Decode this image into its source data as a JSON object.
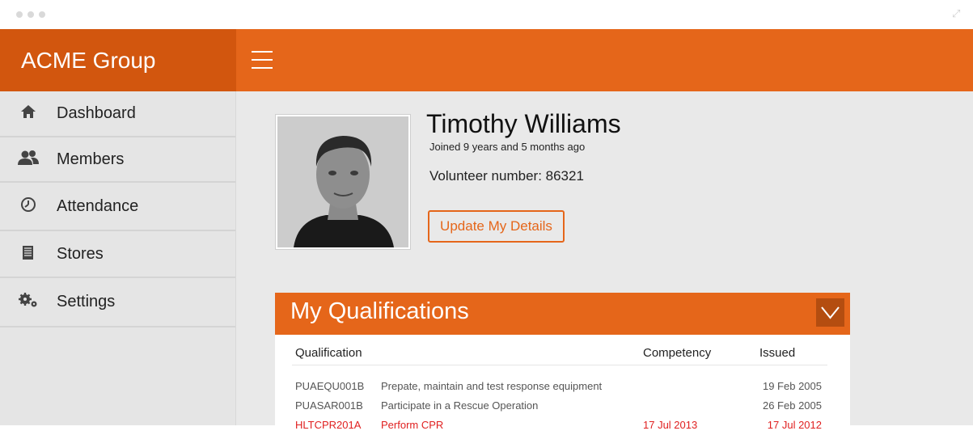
{
  "app": {
    "brand": "ACME Group",
    "accent": "#e5661a",
    "accent_dark": "#d2560e"
  },
  "sidebar": {
    "items": [
      {
        "label": "Dashboard",
        "icon": "home-icon"
      },
      {
        "label": "Members",
        "icon": "members-icon"
      },
      {
        "label": "Attendance",
        "icon": "clock-icon"
      },
      {
        "label": "Stores",
        "icon": "stores-icon"
      },
      {
        "label": "Settings",
        "icon": "gears-icon"
      }
    ]
  },
  "profile": {
    "name": "Timothy Williams",
    "joined": "Joined 9 years and 5 months ago",
    "volunteer": "Volunteer number: 86321",
    "update_label": "Update My Details"
  },
  "qualifications": {
    "title": "My Qualifications",
    "headers": {
      "qualification": "Qualification",
      "competency": "Competency",
      "issued": "Issued"
    },
    "rows": [
      {
        "code": "PUAEQU001B",
        "desc": "Prepate, maintain and test response equipment",
        "competency": "",
        "issued": "19 Feb 2005"
      },
      {
        "code": "PUASAR001B",
        "desc": "Participate in a Rescue Operation",
        "competency": "",
        "issued": "26 Feb 2005"
      },
      {
        "code": "HLTCPR201A",
        "desc": "Perform CPR",
        "competency": "17 Jul 2013",
        "issued": "17 Jul 2012"
      }
    ]
  }
}
